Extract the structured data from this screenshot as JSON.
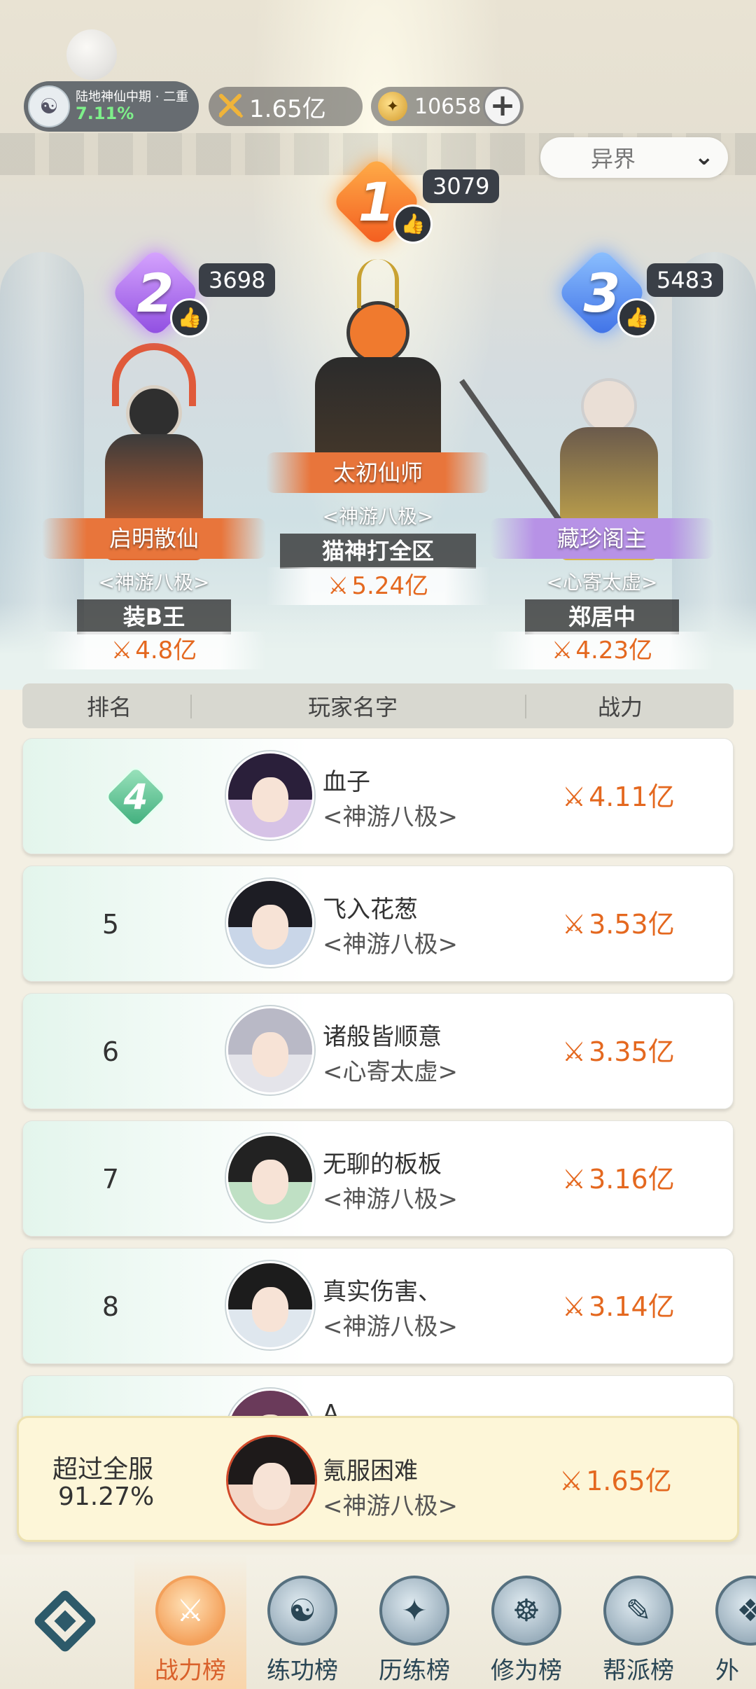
{
  "header": {
    "realm": "陆地神仙中期 · 二重",
    "realm_progress": "7.11%",
    "power": "1.65亿",
    "coins": "10658",
    "add_icon": "plus-icon",
    "server_filter": "异界"
  },
  "podium": [
    {
      "rank": "1",
      "likes": "3079",
      "title": "太初仙师",
      "guild": "<神游八极>",
      "name": "猫神打全区",
      "power": "5.24亿"
    },
    {
      "rank": "2",
      "likes": "3698",
      "title": "启明散仙",
      "guild": "<神游八极>",
      "name": "装B王",
      "power": "4.8亿"
    },
    {
      "rank": "3",
      "likes": "5483",
      "title": "藏珍阁主",
      "guild": "<心寄太虚>",
      "name": "郑居中",
      "power": "4.23亿"
    }
  ],
  "table": {
    "headers": [
      "排名",
      "玩家名字",
      "战力"
    ],
    "rows": [
      {
        "rank": "4",
        "name": "血子",
        "guild": "<神游八极>",
        "power": "4.11亿"
      },
      {
        "rank": "5",
        "name": "飞入花葱",
        "guild": "<神游八极>",
        "power": "3.53亿"
      },
      {
        "rank": "6",
        "name": "诸般皆顺意",
        "guild": "<心寄太虚>",
        "power": "3.35亿"
      },
      {
        "rank": "7",
        "name": "无聊的板板",
        "guild": "<神游八极>",
        "power": "3.16亿"
      },
      {
        "rank": "8",
        "name": "真实伤害、",
        "guild": "<神游八极>",
        "power": "3.14亿"
      },
      {
        "rank": "",
        "name": "A",
        "guild": "",
        "power": ""
      }
    ]
  },
  "self": {
    "line1": "超过全服",
    "line2": "91.27%",
    "name": "氪服困难",
    "guild": "<神游八极>",
    "power": "1.65亿"
  },
  "tabs": [
    {
      "label": "战力榜",
      "icon": "swords-icon",
      "active": true
    },
    {
      "label": "练功榜",
      "icon": "yin-yang-icon",
      "active": false
    },
    {
      "label": "历练榜",
      "icon": "star-compass-icon",
      "active": false
    },
    {
      "label": "修为榜",
      "icon": "meditation-icon",
      "active": false
    },
    {
      "label": "帮派榜",
      "icon": "scroll-icon",
      "active": false
    },
    {
      "label": "外观",
      "icon": "costume-icon",
      "active": false
    }
  ],
  "colors": {
    "power_text": "#e4681f",
    "active_tab": "#d9602a",
    "rank4_badge": "#3fae7c"
  }
}
